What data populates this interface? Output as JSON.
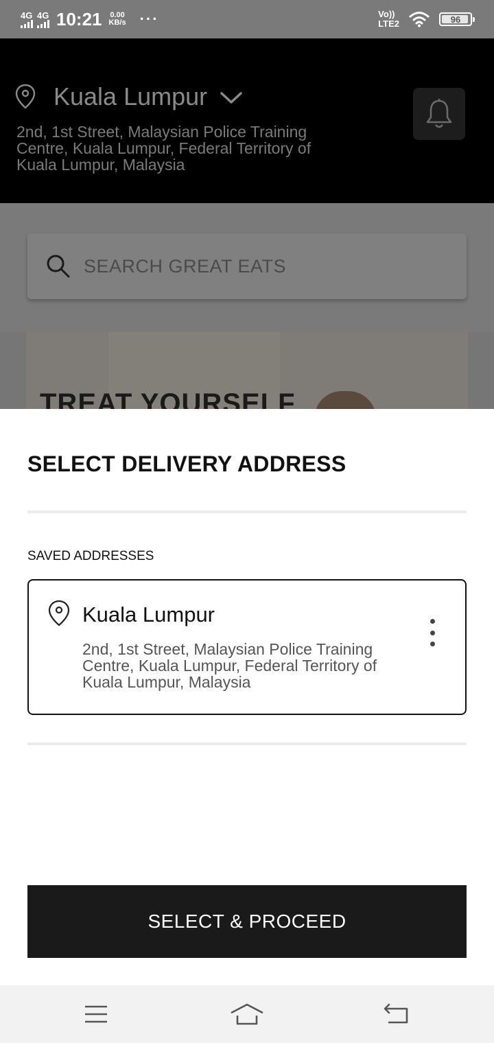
{
  "status_bar": {
    "signal1": "4G",
    "signal2": "4G",
    "time": "10:21",
    "speed_value": "0.00",
    "speed_unit": "KB/s",
    "more": "···",
    "volte_top": "Vo))",
    "volte_bottom": "LTE2",
    "battery": "96",
    "battery_level": 0.96
  },
  "header": {
    "city": "Kuala Lumpur",
    "address": "2nd, 1st Street, Malaysian Police Training Centre, Kuala Lumpur, Federal Territory of Kuala Lumpur, Malaysia"
  },
  "search": {
    "placeholder": "SEARCH GREAT EATS"
  },
  "banner": {
    "text": "TREAT YOURSELF"
  },
  "sheet": {
    "title": "SELECT DELIVERY ADDRESS",
    "saved_label": "SAVED ADDRESSES",
    "addresses": [
      {
        "name": "Kuala Lumpur",
        "address": "2nd, 1st Street, Malaysian Police Training Centre, Kuala Lumpur, Federal Territory of Kuala Lumpur, Malaysia"
      }
    ],
    "proceed_label": "SELECT & PROCEED"
  },
  "icons": {
    "location": "map-pin-icon",
    "chevron": "chevron-down-icon",
    "bell": "bell-icon",
    "search": "search-icon",
    "more": "more-vertical-icon",
    "nav_menu": "menu-icon",
    "nav_home": "home-icon",
    "nav_back": "back-icon"
  }
}
